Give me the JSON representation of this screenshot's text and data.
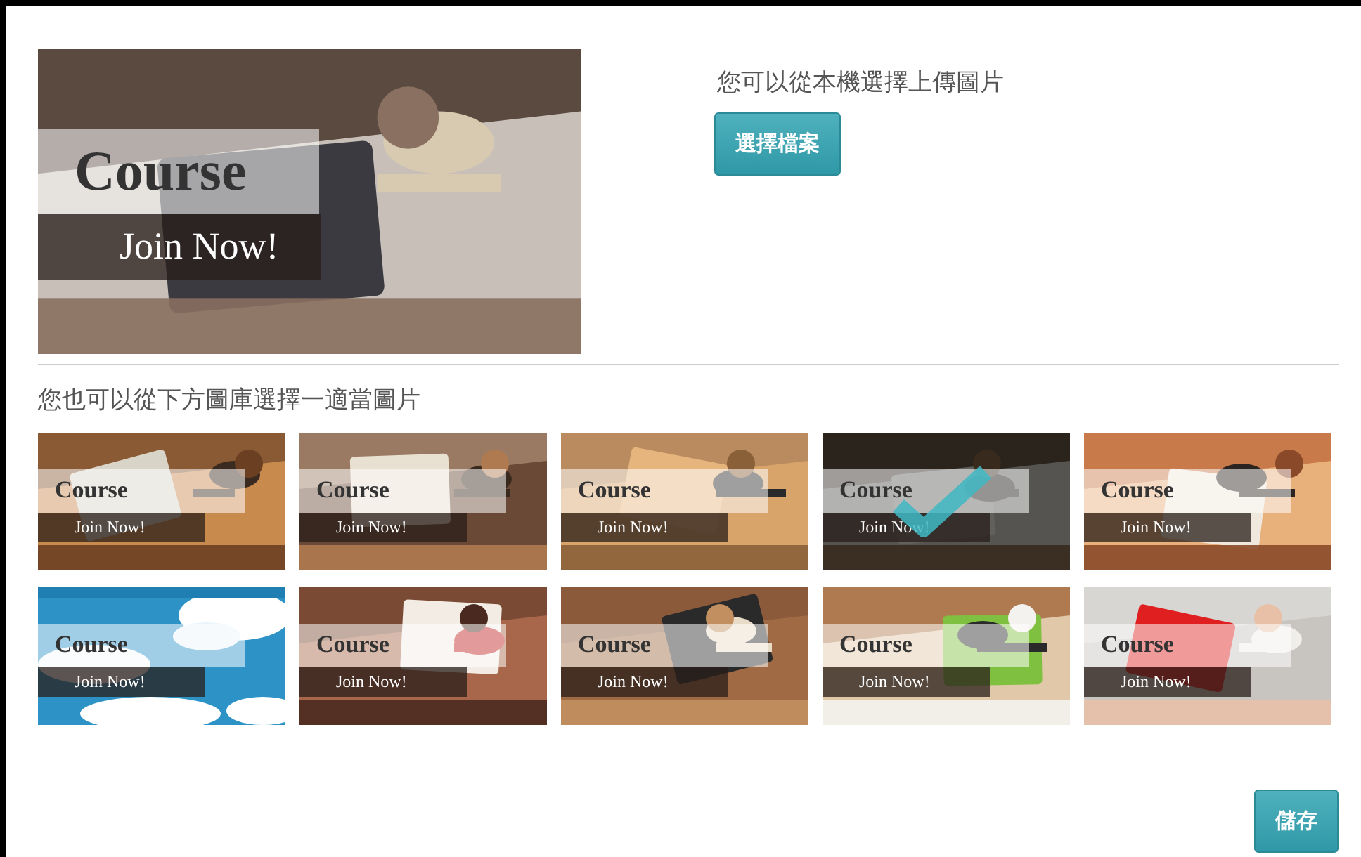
{
  "preview": {
    "title": "Course",
    "cta": "Join Now!"
  },
  "upload": {
    "prompt": "您可以從本機選擇上傳圖片",
    "button": "選擇檔案"
  },
  "gallery_label": "您也可以從下方圖庫選擇一適當圖片",
  "thumbnails": [
    {
      "title": "Course",
      "cta": "Join Now!",
      "selected": false
    },
    {
      "title": "Course",
      "cta": "Join Now!",
      "selected": false
    },
    {
      "title": "Course",
      "cta": "Join Now!",
      "selected": false
    },
    {
      "title": "Course",
      "cta": "Join Now!",
      "selected": true
    },
    {
      "title": "Course",
      "cta": "Join Now!",
      "selected": false
    },
    {
      "title": "Course",
      "cta": "Join Now!",
      "selected": false
    },
    {
      "title": "Course",
      "cta": "Join Now!",
      "selected": false
    },
    {
      "title": "Course",
      "cta": "Join Now!",
      "selected": false
    },
    {
      "title": "Course",
      "cta": "Join Now!",
      "selected": false
    },
    {
      "title": "Course",
      "cta": "Join Now!",
      "selected": false
    }
  ],
  "save_button": "儲存"
}
